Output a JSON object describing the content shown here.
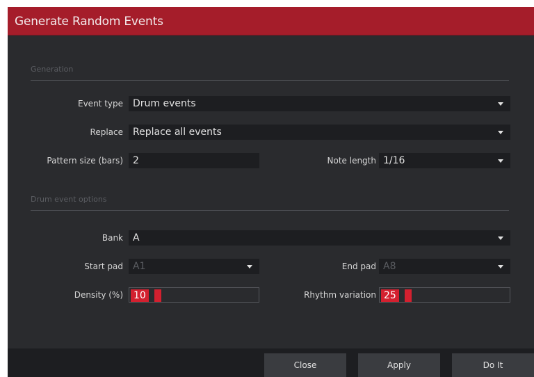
{
  "window": {
    "title": "Generate Random Events"
  },
  "generation": {
    "section_label": "Generation",
    "event_type": {
      "label": "Event type",
      "value": "Drum events"
    },
    "replace": {
      "label": "Replace",
      "value": "Replace all events"
    },
    "pattern_size": {
      "label": "Pattern size (bars)",
      "value": "2"
    },
    "note_length": {
      "label": "Note length",
      "value": "1/16"
    }
  },
  "drum_options": {
    "section_label": "Drum event options",
    "bank": {
      "label": "Bank",
      "value": "A"
    },
    "start_pad": {
      "label": "Start pad",
      "value": "A1"
    },
    "end_pad": {
      "label": "End pad",
      "value": "A8"
    },
    "density": {
      "label": "Density (%)",
      "value": "10"
    },
    "rhythm_variation": {
      "label": "Rhythm variation",
      "value": "25"
    }
  },
  "buttons": {
    "close": "Close",
    "apply": "Apply",
    "do_it": "Do It"
  },
  "colors": {
    "title_bar": "#a51d2a",
    "background": "#2a2b2e",
    "field": "#1d1e21",
    "highlight": "#d3202f"
  }
}
